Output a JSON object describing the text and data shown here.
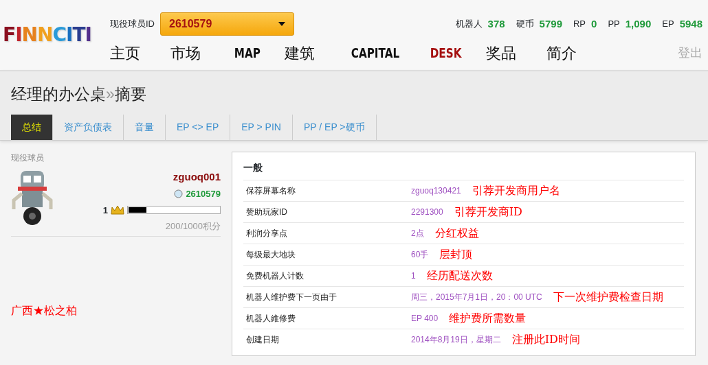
{
  "header": {
    "logo": "FINNCITI",
    "player_label": "现役球员ID",
    "player_id": "2610579",
    "stats": [
      {
        "label": "机器人",
        "value": "378"
      },
      {
        "label": "硬币",
        "value": "5799"
      },
      {
        "label": "RP",
        "value": "0"
      },
      {
        "label": "PP",
        "value": "1,090"
      },
      {
        "label": "EP",
        "value": "5948"
      }
    ],
    "nav": [
      {
        "label": "主页",
        "selected": false
      },
      {
        "label": "市场",
        "selected": false
      },
      {
        "label": "MAP",
        "selected": false
      },
      {
        "label": "建筑",
        "selected": false
      },
      {
        "label": "CAPITAL",
        "selected": false
      },
      {
        "label": "DESK",
        "selected": true
      },
      {
        "label": "奖品",
        "selected": false
      },
      {
        "label": "简介",
        "selected": false
      }
    ],
    "logout": "登出"
  },
  "page": {
    "title": "经理的办公桌",
    "separator": "»",
    "subtitle": "摘要",
    "tabs": [
      {
        "label": "总结",
        "selected": true
      },
      {
        "label": "资产负债表",
        "selected": false
      },
      {
        "label": "音量",
        "selected": false
      },
      {
        "label": "EP <> EP",
        "selected": false
      },
      {
        "label": "EP > PIN",
        "selected": false
      },
      {
        "label": "PP / EP >硬币",
        "selected": false
      }
    ]
  },
  "player": {
    "heading": "现役球员",
    "name": "zguoq001",
    "id": "2610579",
    "rank": "1",
    "level": 0.2,
    "points": "200/1000积分"
  },
  "note": "广西★松之柏",
  "general": {
    "title": "一般",
    "rows": [
      {
        "label": "保荐屏幕名称",
        "value": "zguoq130421",
        "note": "引荐开发商用户名"
      },
      {
        "label": "赞助玩家ID",
        "value": "2291300",
        "note": "引荐开发商ID"
      },
      {
        "label": "利润分享点",
        "value": "2点",
        "note": "分红权益"
      },
      {
        "label": "每级最大地块",
        "value": "60手",
        "note": "层封顶"
      },
      {
        "label": "免费机器人计数",
        "value": "1",
        "note": "经历配送次数"
      },
      {
        "label": "机器人维护费下一页由于",
        "value": "周三，2015年7月1日，20：00 UTC",
        "note": "下一次维护费检查日期"
      },
      {
        "label": "机器人維修费",
        "value": "EP 400",
        "note": "维护费所需数量"
      },
      {
        "label": "创建日期",
        "value": "2014年8月19日，星期二",
        "note": "注册此ID时间"
      }
    ]
  }
}
